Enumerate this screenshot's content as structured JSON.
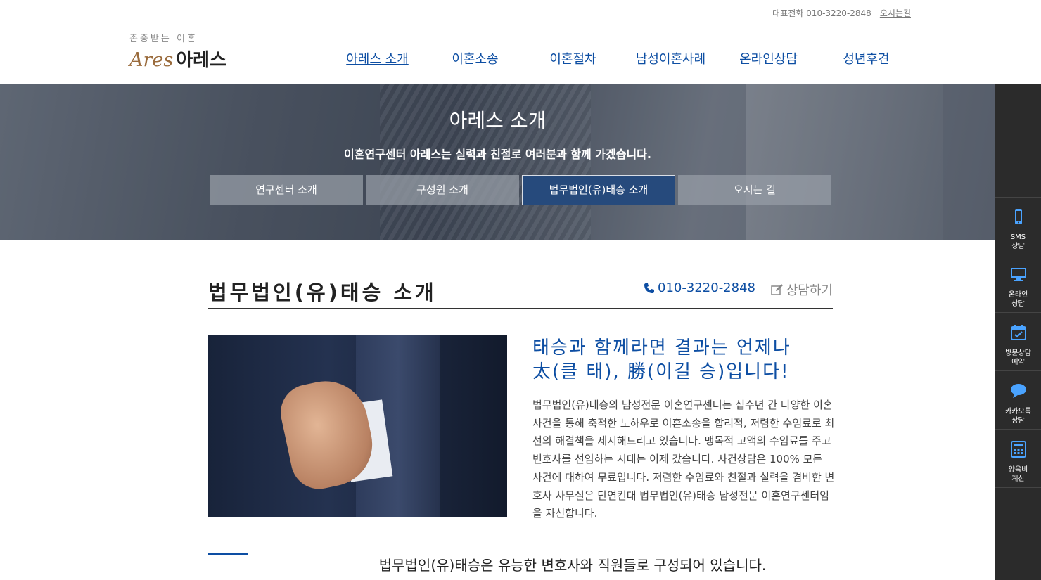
{
  "topbar": {
    "phone_label": "대표전화",
    "phone": "010-3220-2848",
    "directions": "오시는길"
  },
  "logo": {
    "slogan": "존중받는 이혼",
    "brand_en": "Ares",
    "brand_ko": "아레스"
  },
  "gnb": {
    "items": [
      {
        "label": "아레스 소개",
        "active": true
      },
      {
        "label": "이혼소송"
      },
      {
        "label": "이혼절차"
      },
      {
        "label": "남성이혼사례"
      },
      {
        "label": "온라인상담"
      },
      {
        "label": "성년후견"
      }
    ]
  },
  "hero": {
    "title": "아레스 소개",
    "description": "이혼연구센터 아레스는 실력과 친절로 여러분과 함께 가겠습니다.",
    "tabs": [
      {
        "label": "연구센터 소개"
      },
      {
        "label": "구성원 소개"
      },
      {
        "label": "법무법인(유)태승 소개",
        "active": true
      },
      {
        "label": "오시는 길"
      }
    ]
  },
  "quick_menu": {
    "items": [
      {
        "label": "SMS\n상담",
        "icon": "mobile-phone-icon"
      },
      {
        "label": "온라인\n상담",
        "icon": "monitor-icon"
      },
      {
        "label": "방문상담\n예약",
        "icon": "calendar-check-icon"
      },
      {
        "label": "카카오톡\n상담",
        "icon": "chat-bubble-icon"
      },
      {
        "label": "양육비\n계산",
        "icon": "calculator-icon"
      }
    ]
  },
  "content": {
    "title": "법무법인(유)태승 소개",
    "phone": "010-3220-2848",
    "consult": "상담하기",
    "headline_line1": "태승과 함께라면 결과는 언제나",
    "headline_line2": "太(클 태), 勝(이길 승)입니다!",
    "body": "법무법인(유)태승의 남성전문 이혼연구센터는 십수년 간 다양한 이혼 사건을 통해 축적한 노하우로 이혼소송을 합리적, 저렴한 수임료로 최선의 해결책을 제시해드리고 있습니다. 맹목적 고액의 수임료를 주고 변호사를 선임하는 시대는 이제 갔습니다. 사건상담은 100% 모든 사건에 대하여 무료입니다. 저렴한 수임료와 친절과 실력을 겸비한 변호사 사무실은 단연컨대 법무법인(유)태승 남성전문 이혼연구센터임을 자신합니다.",
    "subtitle": "법무법인(유)태승은 유능한 변호사와 직원들로 구성되어 있습니다."
  },
  "colors": {
    "brand_blue": "#0d4ea3",
    "quick_bg": "#2b2b2b",
    "active_tab": "#264a7c"
  }
}
